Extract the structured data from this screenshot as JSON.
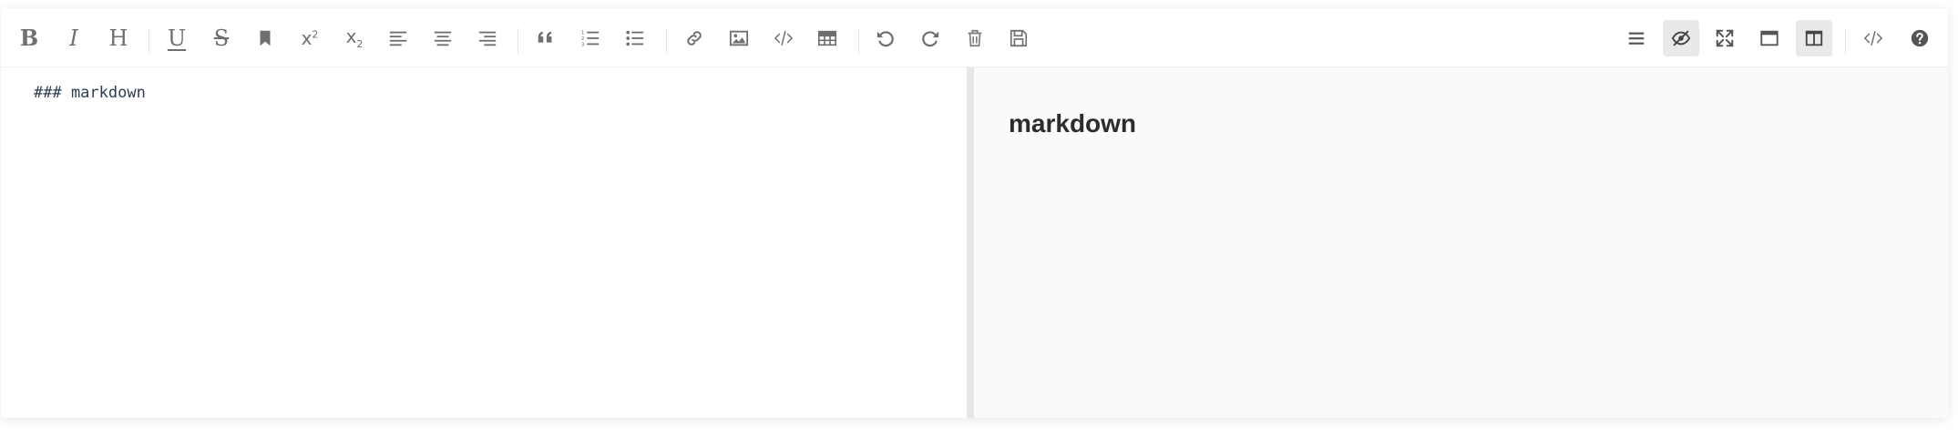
{
  "toolbar": {
    "left_tools": [
      {
        "id": "bold",
        "icon": "bold-icon",
        "glyph": "B"
      },
      {
        "id": "italic",
        "icon": "italic-icon",
        "glyph": "I"
      },
      {
        "id": "header",
        "icon": "header-icon",
        "glyph": "H"
      },
      {
        "id": "underline",
        "icon": "underline-icon",
        "glyph": "U"
      },
      {
        "id": "strikethrough",
        "icon": "strikethrough-icon",
        "glyph": "S"
      },
      {
        "id": "mark",
        "icon": "bookmark-icon"
      },
      {
        "id": "superscript",
        "icon": "superscript-icon",
        "glyph": "x",
        "script": "2"
      },
      {
        "id": "subscript",
        "icon": "subscript-icon",
        "glyph": "x",
        "script": "2"
      },
      {
        "id": "align-left",
        "icon": "align-left-icon"
      },
      {
        "id": "align-center",
        "icon": "align-center-icon"
      },
      {
        "id": "align-right",
        "icon": "align-right-icon"
      },
      {
        "id": "quote",
        "icon": "quote-icon"
      },
      {
        "id": "ordered-list",
        "icon": "ordered-list-icon"
      },
      {
        "id": "unordered-list",
        "icon": "unordered-list-icon"
      },
      {
        "id": "link",
        "icon": "link-icon"
      },
      {
        "id": "image",
        "icon": "image-icon"
      },
      {
        "id": "code",
        "icon": "code-icon"
      },
      {
        "id": "table",
        "icon": "table-icon"
      },
      {
        "id": "undo",
        "icon": "undo-icon"
      },
      {
        "id": "redo",
        "icon": "redo-icon"
      },
      {
        "id": "trash",
        "icon": "trash-icon"
      },
      {
        "id": "save",
        "icon": "save-icon"
      }
    ],
    "right_tools": [
      {
        "id": "navigation",
        "icon": "menu-icon",
        "active": false
      },
      {
        "id": "preview-toggle",
        "icon": "eye-slash-icon",
        "active": true
      },
      {
        "id": "fullscreen",
        "icon": "expand-icon",
        "active": false
      },
      {
        "id": "read-mode",
        "icon": "window-icon",
        "active": false
      },
      {
        "id": "subfield",
        "icon": "columns-icon",
        "active": true
      },
      {
        "id": "html-code",
        "icon": "code-icon",
        "active": false
      },
      {
        "id": "help",
        "icon": "help-icon",
        "active": false
      }
    ]
  },
  "editor": {
    "source_text": "### markdown"
  },
  "preview": {
    "heading": "markdown"
  },
  "colors": {
    "icon": "#757575",
    "active_bg": "#e9e9eb",
    "preview_bg": "#fafafa",
    "splitter": "#e6e6e6"
  }
}
